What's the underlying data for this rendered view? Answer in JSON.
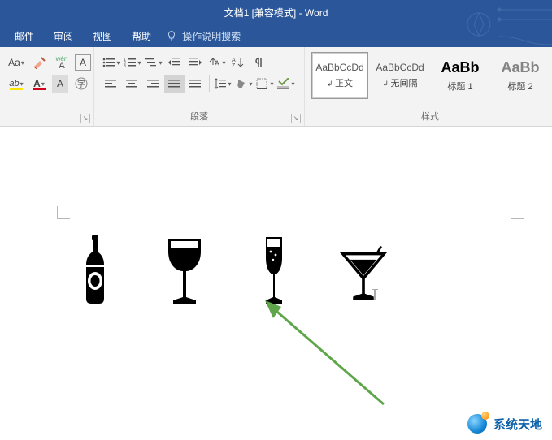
{
  "app": {
    "title": "文档1 [兼容模式] - Word"
  },
  "menu": {
    "items": [
      {
        "label": "邮件"
      },
      {
        "label": "审阅"
      },
      {
        "label": "视图"
      },
      {
        "label": "帮助"
      }
    ],
    "tell_me": "操作说明搜索"
  },
  "ribbon": {
    "font": {
      "case_label": "Aa",
      "phonetic": "wén",
      "clear_fmt": "A",
      "char_border": "A",
      "char_shading": "A",
      "font_color": "A",
      "highlight": "ab"
    },
    "paragraph": {
      "group_label": "段落"
    },
    "styles": {
      "group_label": "样式",
      "items": [
        {
          "preview": "AaBbCcDd",
          "label": "正文",
          "selected": true,
          "size": "small"
        },
        {
          "preview": "AaBbCcDd",
          "label": "无间隔",
          "selected": false,
          "size": "small"
        },
        {
          "preview": "AaBb",
          "label": "标题 1",
          "selected": false,
          "size": "big"
        },
        {
          "preview": "AaBb",
          "label": "标题 2",
          "selected": false,
          "size": "big2"
        }
      ]
    }
  },
  "document": {
    "icons": [
      "bottle",
      "wine-glass",
      "champagne",
      "martini"
    ]
  },
  "watermark": {
    "text": "系统天地"
  }
}
